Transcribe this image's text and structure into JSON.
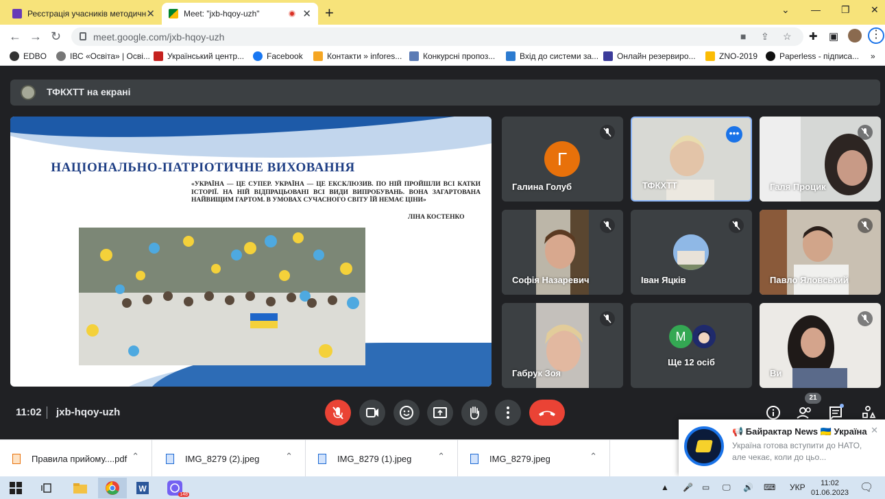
{
  "browser": {
    "tabs": [
      {
        "title": "Реєстрація учасників методичн",
        "close": "✕"
      },
      {
        "title": "Meet: \"jxb-hqoy-uzh\"",
        "close": "✕"
      }
    ],
    "new_tab": "+",
    "window_controls": {
      "chevron": "⌄",
      "minimize": "—",
      "restore": "❐",
      "close": "✕"
    },
    "url": "meet.google.com/jxb-hqoy-uzh",
    "bookmarks": [
      "EDBO",
      "ІВС «Освіта» | Осві...",
      "Український центр...",
      "Facebook",
      "Контакти » infores...",
      "Конкурсні пропоз...",
      "Вхід до системи за...",
      "Онлайн резервиро...",
      "ZNO-2019",
      "Paperless - підписа..."
    ],
    "bookmarks_more": "»"
  },
  "meet": {
    "presenting_banner": "ТФКХТТ на екрані",
    "slide": {
      "title": "НАЦІОНАЛЬНО-ПАТРІОТИЧНЕ ВИХОВАННЯ",
      "quote": "«УКРАЇНА — ЦЕ СУПЕР. УКРАЇНА — ЦЕ ЕКСКЛЮЗИВ. ПО НІЙ ПРОЙШЛИ ВСІ КАТКИ ІСТОРІЇ. НА НІЙ ВІДПРАЦЬОВАНІ ВСІ ВИДИ ВИПРОБУВАНЬ. ВОНА ЗАГАРТОВАНА НАЙВИЩИМ ГАРТОМ. В УМОВАХ СУЧАСНОГО СВІТУ ЇЙ НЕМАЄ ЦІНИ»",
      "author": "ЛІНА КОСТЕНКО"
    },
    "participants": [
      {
        "name": "Галина Голуб",
        "avatar_letter": "Г",
        "avatar_color": "#e8710a"
      },
      {
        "name": "ТФКХТТ",
        "more": "•••"
      },
      {
        "name": "Галя Процик"
      },
      {
        "name": "Софія Назаревич"
      },
      {
        "name": "Іван Яцків"
      },
      {
        "name": "Павло Яловський"
      },
      {
        "name": "Габрук Зоя"
      },
      {
        "name": "Ще 12 осіб",
        "avatar_letter": "M",
        "avatar_color": "#34a853"
      },
      {
        "name": "Ви"
      }
    ],
    "time": "11:02",
    "separator": "|",
    "meeting_code": "jxb-hqoy-uzh",
    "participant_count": "21",
    "colors": {
      "end_call": "#ea4335",
      "mic_off": "#ea4335",
      "accent": "#8ab4f8"
    }
  },
  "downloads": [
    {
      "name": "Правила прийому....pdf",
      "type": "pdf"
    },
    {
      "name": "IMG_8279 (2).jpeg",
      "type": "image"
    },
    {
      "name": "IMG_8279 (1).jpeg",
      "type": "image"
    },
    {
      "name": "IMG_8279.jpeg",
      "type": "image"
    }
  ],
  "notification": {
    "title": "📢 Байрактар News 🇺🇦 Україна",
    "body": "Україна готова вступити до НАТО, але чекає, коли до цьо...",
    "close": "✕"
  },
  "taskbar": {
    "language": "УКР",
    "clock_time": "11:02",
    "clock_date": "01.06.2023",
    "viber_badge": "148"
  }
}
